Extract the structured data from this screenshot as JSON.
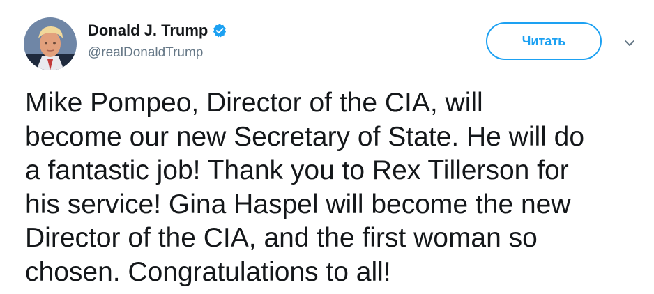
{
  "author": {
    "display_name": "Donald J. Trump",
    "handle": "@realDonaldTrump",
    "verified_icon": "verified-badge-icon",
    "avatar_icon": "avatar"
  },
  "actions": {
    "follow_label": "Читать",
    "caret_icon": "chevron-down-icon"
  },
  "tweet": {
    "text": "Mike Pompeo, Director of the CIA, will\nbecome our new Secretary of State. He will do\na fantastic job! Thank you to Rex Tillerson for\nhis service! Gina Haspel will become the new\nDirector of the CIA, and the first woman so\nchosen. Congratulations to all!"
  },
  "colors": {
    "accent": "#1da1f2",
    "text_primary": "#14171a",
    "text_secondary": "#657786"
  }
}
